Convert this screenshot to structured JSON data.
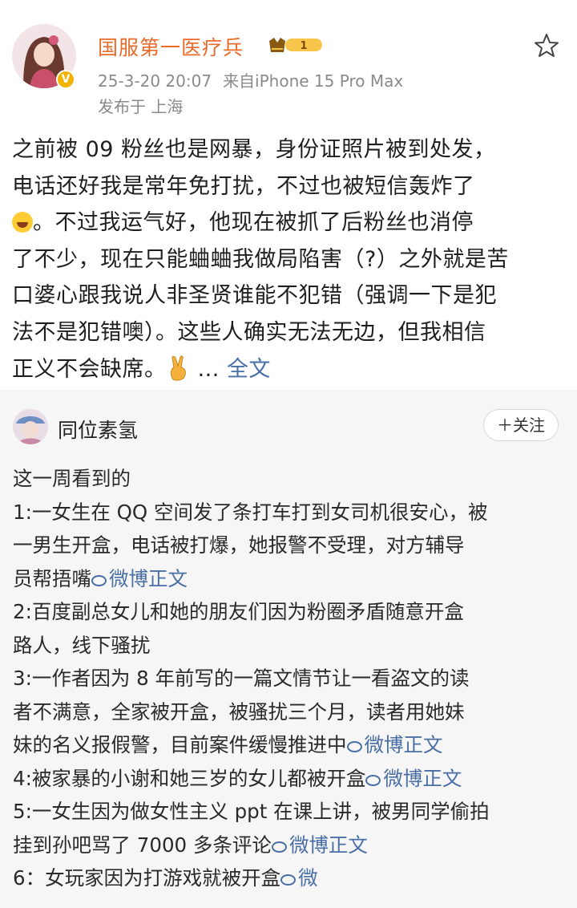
{
  "post": {
    "username": "国服第一医疗兵",
    "level_badge": "1",
    "verified_badge": "V",
    "timestamp": "25-3-20 20:07",
    "source": "来自iPhone 15 Pro Max",
    "location": "发布于 上海",
    "body_lines": [
      "之前被 09 粉丝也是网暴，身份证照片被到处发，",
      "电话还好我是常年免打扰，不过也被短信轰炸了",
      "。不过我运气好，他现在被抓了后粉丝也消停",
      "了不少，现在只能蛐蛐我做局陷害（?）之外就是苦",
      "口婆心跟我说人非圣贤谁能不犯错（强调一下是犯",
      "法不是犯错噢）。这些人确实无法无边，但我相信",
      "正义不会缺席。"
    ],
    "ellipsis": "...",
    "full_text_link": "全文",
    "icons": {
      "laugh": "laugh-emoji",
      "victory": "victory-hand-emoji",
      "favorite": "star-icon"
    }
  },
  "repost": {
    "username": "同位素氢",
    "follow_label": "＋关注",
    "intro": "这一周看到的",
    "items": [
      {
        "lines": [
          "1:一女生在 QQ 空间发了条打车打到女司机很安心，被",
          "一男生开盒，电话被打爆，她报警不受理，对方辅导",
          "员帮捂嘴"
        ],
        "link": "微博正文"
      },
      {
        "lines": [
          "2:百度副总女儿和她的朋友们因为粉圈矛盾随意开盒",
          "路人，线下骚扰"
        ],
        "link": ""
      },
      {
        "lines": [
          "3:一作者因为 8 年前写的一篇文情节让一看盗文的读",
          "者不满意，全家被开盒，被骚扰三个月，读者用她妹",
          "妹的名义报假警，目前案件缓慢推进中"
        ],
        "link": "微博正文"
      },
      {
        "lines": [
          "4:被家暴的小谢和她三岁的女儿都被开盒"
        ],
        "link": "微博正文"
      },
      {
        "lines": [
          "5:一女生因为做女性主义 ppt 在课上讲，被男同学偷拍",
          "挂到孙吧骂了 7000 多条评论"
        ],
        "link": "微博正文"
      },
      {
        "lines": [
          "6：女玩家因为打游戏就被开盒"
        ],
        "link": "微"
      }
    ],
    "link_icon": "weibo-link-icon"
  },
  "colors": {
    "username_orange": "#e86b2a",
    "link_blue": "#4a6fa5",
    "meta_gray": "#8a8a8a",
    "repost_bg": "#f6f6f6",
    "badge_gold": "#f5b301"
  }
}
